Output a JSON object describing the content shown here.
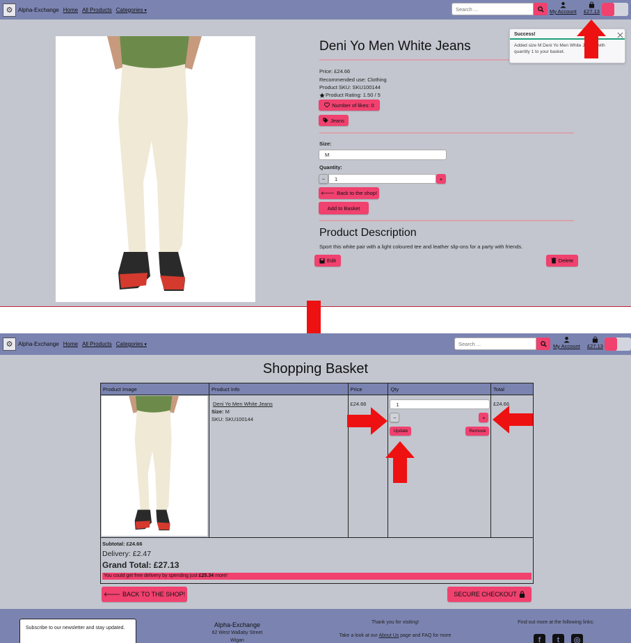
{
  "nav": {
    "brand": "Alpha-Exchange",
    "home": "Home",
    "all_products": "All Products",
    "categories": "Categories",
    "search_placeholder": "Search ...",
    "account": "My Account",
    "basket_total": "£27.13"
  },
  "colors": {
    "navbar": "#7b84b1",
    "accent": "#f0416f",
    "page_bg": "#c3c6cf",
    "arrow": "#ee1111",
    "toast_success": "#1e9e7a"
  },
  "product": {
    "name": "Deni Yo Men White Jeans",
    "price": "Price: £24.66",
    "recommended": "Recommended use: Clothing",
    "sku": "Product SKU: SKU100144",
    "rating": "Product Rating: 1.50 / 5",
    "likes": "Number of likes: 0",
    "tag": "Jeans",
    "size_label": "Size:",
    "size_value": "M",
    "qty_label": "Quantity:",
    "qty_value": "1",
    "back_btn": "Back to the shop!",
    "add_btn": "Add to Basket",
    "desc_title": "Product Description",
    "desc_text": "Sport this white pair with a light coloured tee and leather slip-ons for a party with friends.",
    "edit": "Edit",
    "delete": "Delete"
  },
  "toast": {
    "title": "Success!",
    "message": "Added size M Deni Yo Men White Jeans, with quantity 1 to your basket."
  },
  "basket": {
    "title": "Shopping Basket",
    "headers": [
      "Product Image",
      "Product Info",
      "Price",
      "Qty",
      "Total"
    ],
    "item_name": "Deni Yo Men White Jeans",
    "size_label": "Size:",
    "size_value": "M",
    "sku": "SKU: SKU100144",
    "price": "£24.66",
    "qty": "1",
    "update": "Update",
    "remove": "Remove",
    "total": "£24.66",
    "subtotal": "Subtotal: £24.66",
    "delivery": "Delivery: £2.47",
    "grand_total": "Grand Total: £27.13",
    "free_delivery_prefix": "You could get free delivery by spending just",
    "free_delivery_amount": "£25.34",
    "free_delivery_suffix": "more!",
    "back_btn": "BACK TO THE SHOP!",
    "checkout_btn": "SECURE CHECKOUT"
  },
  "footer": {
    "newsletter": "Subscribe to our newsletter and stay updated.",
    "company": "Alpha-Exchange",
    "address1": "62 West Wallaby Street",
    "address2": "Wigan",
    "thanks": "Thank you for visiting!",
    "about_prefix": "Take a look at our",
    "about_link": "About Us",
    "about_suffix": "page and FAQ for more",
    "links_text": "Find out more at the following links:"
  }
}
